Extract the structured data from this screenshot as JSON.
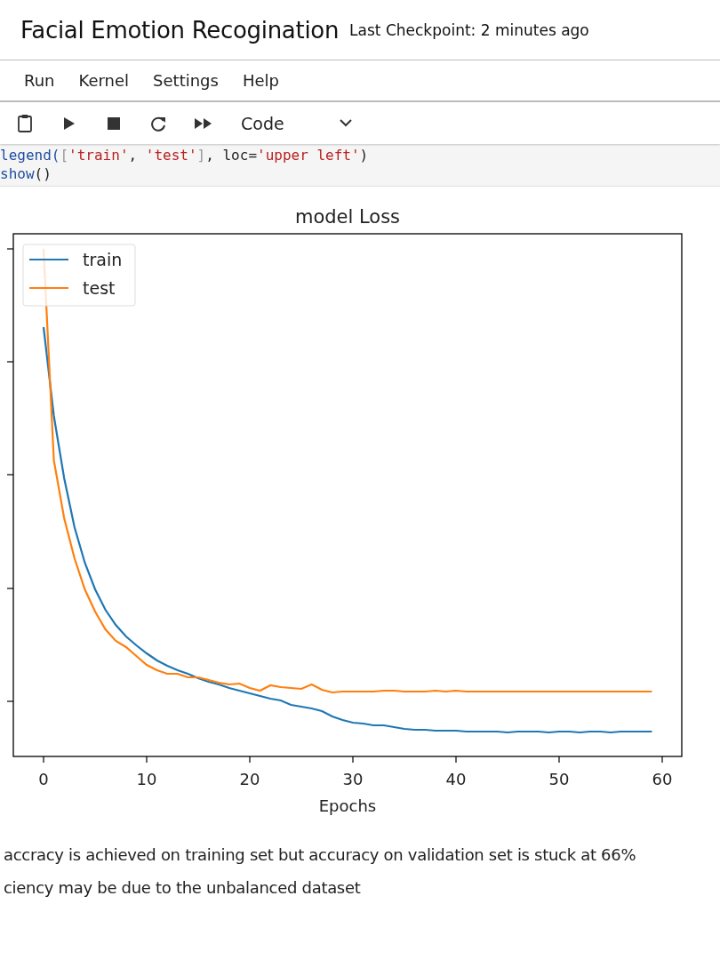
{
  "header": {
    "title": "Facial Emotion Recogination",
    "checkpoint": "Last Checkpoint: 2 minutes ago"
  },
  "menu": [
    "Run",
    "Kernel",
    "Settings",
    "Help"
  ],
  "toolbar": {
    "buttons": [
      {
        "kind": "clipboard"
      },
      {
        "kind": "run"
      },
      {
        "kind": "stop"
      },
      {
        "kind": "restart"
      },
      {
        "kind": "run-all"
      }
    ],
    "cell_type": "Code"
  },
  "code_lines": [
    [
      {
        "kind": "name",
        "text": "legend("
      },
      {
        "kind": "punct",
        "text": "["
      },
      {
        "kind": "string",
        "text": "'train'"
      },
      {
        "kind": "plain",
        "text": ", "
      },
      {
        "kind": "string",
        "text": "'test'"
      },
      {
        "kind": "punct",
        "text": "]"
      },
      {
        "kind": "plain",
        "text": ", loc="
      },
      {
        "kind": "string",
        "text": "'upper left'"
      },
      {
        "kind": "plain",
        "text": ")"
      }
    ],
    [
      {
        "kind": "name",
        "text": "show"
      },
      {
        "kind": "plain",
        "text": "()"
      }
    ]
  ],
  "plot": {
    "title": "model Loss",
    "xlabel": "Epochs",
    "xticks": [
      "0",
      "10",
      "20",
      "30",
      "40",
      "50",
      "60"
    ],
    "legend": [
      {
        "name": "train",
        "color": "#1f77b4"
      },
      {
        "name": "test",
        "color": "#ff7f0e"
      }
    ]
  },
  "notes": [
    "accracy is achieved on training set but accuracy on validation set is stuck at 66%",
    "ciency may be due to the unbalanced dataset"
  ]
}
